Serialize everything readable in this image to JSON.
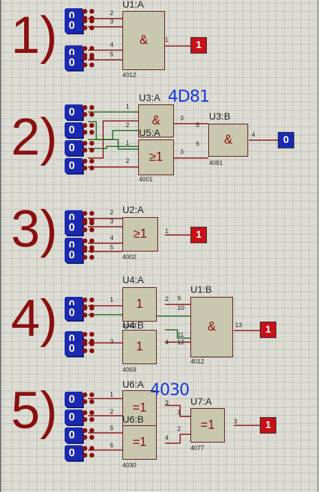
{
  "sections": [
    {
      "id": "1",
      "label": "1)"
    },
    {
      "id": "2",
      "label": "2)"
    },
    {
      "id": "3",
      "label": "3)"
    },
    {
      "id": "4",
      "label": "4)"
    },
    {
      "id": "5",
      "label": "5)"
    }
  ],
  "components": {
    "u1a": {
      "ref": "U1:A",
      "part": "4012",
      "symbol": "&",
      "pins": [
        "2",
        "3",
        "4",
        "5",
        "1"
      ]
    },
    "u3a": {
      "ref": "U3:A",
      "part": "",
      "symbol": "&",
      "pins": [
        "1",
        "2",
        "3"
      ]
    },
    "u5a": {
      "ref": "U5:A",
      "part": "4001",
      "symbol": "≥1",
      "pins": [
        "1",
        "2",
        "3"
      ]
    },
    "u3b": {
      "ref": "U3:B",
      "part": "4081",
      "symbol": "&",
      "pins": [
        "5",
        "6",
        "4"
      ]
    },
    "u2a": {
      "ref": "U2:A",
      "part": "4002",
      "symbol": "≥1",
      "pins": [
        "2",
        "3",
        "4",
        "5",
        "1"
      ]
    },
    "u4a": {
      "ref": "U4:A",
      "part": "4069",
      "symbol": "1",
      "pins": [
        "1",
        "2"
      ]
    },
    "u4b": {
      "ref": "U4:B",
      "part": "4069",
      "symbol": "1",
      "pins": [
        "3",
        "4"
      ]
    },
    "u1b": {
      "ref": "U1:B",
      "part": "4012",
      "symbol": "&",
      "pins": [
        "9",
        "10",
        "11",
        "12",
        "13"
      ]
    },
    "u6a": {
      "ref": "U6:A",
      "part": "",
      "symbol": "=1",
      "pins": [
        "1",
        "2",
        "3"
      ]
    },
    "u6b": {
      "ref": "U6:B",
      "part": "4030",
      "symbol": "=1",
      "pins": [
        "5",
        "6",
        "4"
      ]
    },
    "u7a": {
      "ref": "U7:A",
      "part": "4077",
      "symbol": "=1",
      "pins": [
        "1",
        "2",
        "3"
      ]
    }
  },
  "inputs": {
    "s1": [
      "0",
      "0",
      "0",
      "0"
    ],
    "s2": [
      "0",
      "0",
      "0",
      "0"
    ],
    "s3": [
      "0",
      "0",
      "0",
      "0"
    ],
    "s4": [
      "0",
      "0",
      "0",
      "0"
    ],
    "s5": [
      "0",
      "0",
      "0",
      "0"
    ]
  },
  "outputs": {
    "s1": {
      "value": "1",
      "state": "high"
    },
    "s2": {
      "value": "0",
      "state": "low"
    },
    "s3": {
      "value": "1",
      "state": "high"
    },
    "s4": {
      "value": "1",
      "state": "high"
    },
    "s5": {
      "value": "1",
      "state": "high"
    }
  },
  "annotations": {
    "chip_2": "4D81",
    "chip_5": "4030"
  },
  "colors": {
    "wire": "#8b1010",
    "wire_low": "#1d6a1d",
    "component_fill": "#c9c7ad",
    "section_number": "#8b1010",
    "logic_high": "#c81018",
    "logic_low": "#1a2ab0",
    "annotation": "#1a3ad8",
    "grid_bg": "#dcdcd4"
  }
}
